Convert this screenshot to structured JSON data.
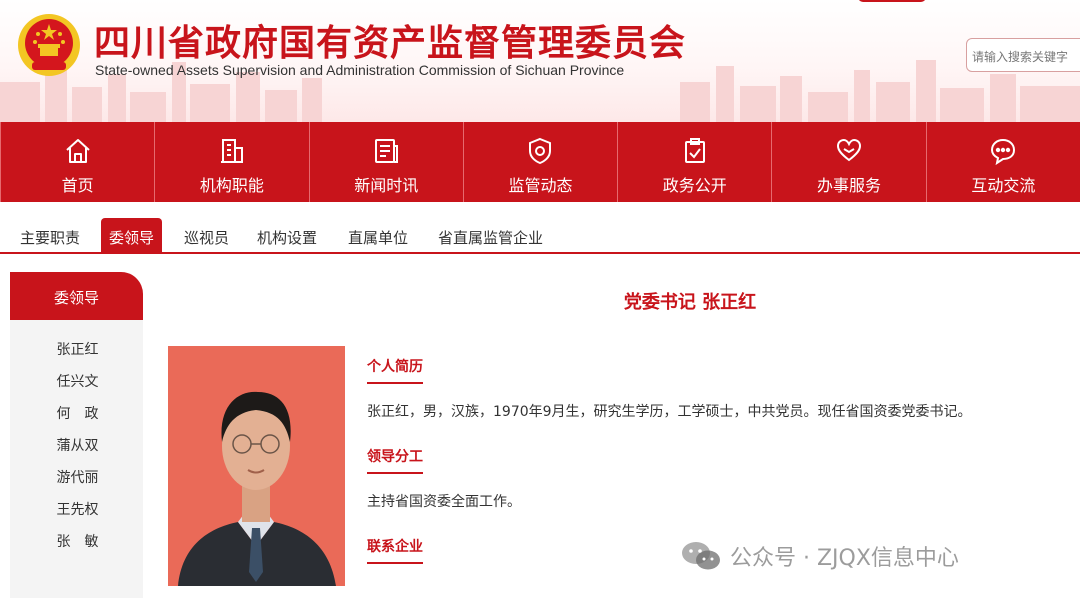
{
  "header": {
    "title_cn": "四川省政府国有资产监督管理委员会",
    "title_en": "State-owned Assets Supervision and Administration Commission of Sichuan Province",
    "search_placeholder": "请输入搜索关键字",
    "emblem_icon": "national-emblem-icon"
  },
  "mainnav": {
    "items": [
      {
        "label": "首页",
        "icon": "home-icon"
      },
      {
        "label": "机构职能",
        "icon": "building-icon"
      },
      {
        "label": "新闻时讯",
        "icon": "news-document-icon"
      },
      {
        "label": "监管动态",
        "icon": "shield-eye-icon"
      },
      {
        "label": "政务公开",
        "icon": "clipboard-check-icon"
      },
      {
        "label": "办事服务",
        "icon": "heart-hands-icon"
      },
      {
        "label": "互动交流",
        "icon": "chat-bubble-icon"
      }
    ]
  },
  "subnav": {
    "tabs": [
      "主要职责",
      "委领导",
      "巡视员",
      "机构设置",
      "直属单位",
      "省直属监管企业"
    ],
    "active": "委领导"
  },
  "sidebar": {
    "heading": "委领导",
    "items": [
      "张正红",
      "任兴文",
      "何　政",
      "蒲从双",
      "游代丽",
      "王先权",
      "张　敏"
    ]
  },
  "content": {
    "title": "党委书记 张正红",
    "sections": [
      {
        "heading": "个人简历",
        "text": "张正红，男，汉族，1970年9月生，研究生学历，工学硕士，中共党员。现任省国资委党委书记。"
      },
      {
        "heading": "领导分工",
        "text": "主持省国资委全面工作。"
      },
      {
        "heading": "联系企业",
        "text": ""
      }
    ]
  },
  "watermark": {
    "text": "公众号 · ZJQX信息中心",
    "icon": "wechat-icon"
  },
  "colors": {
    "brand_red": "#c8141b",
    "photo_bg": "#ea6a58"
  }
}
